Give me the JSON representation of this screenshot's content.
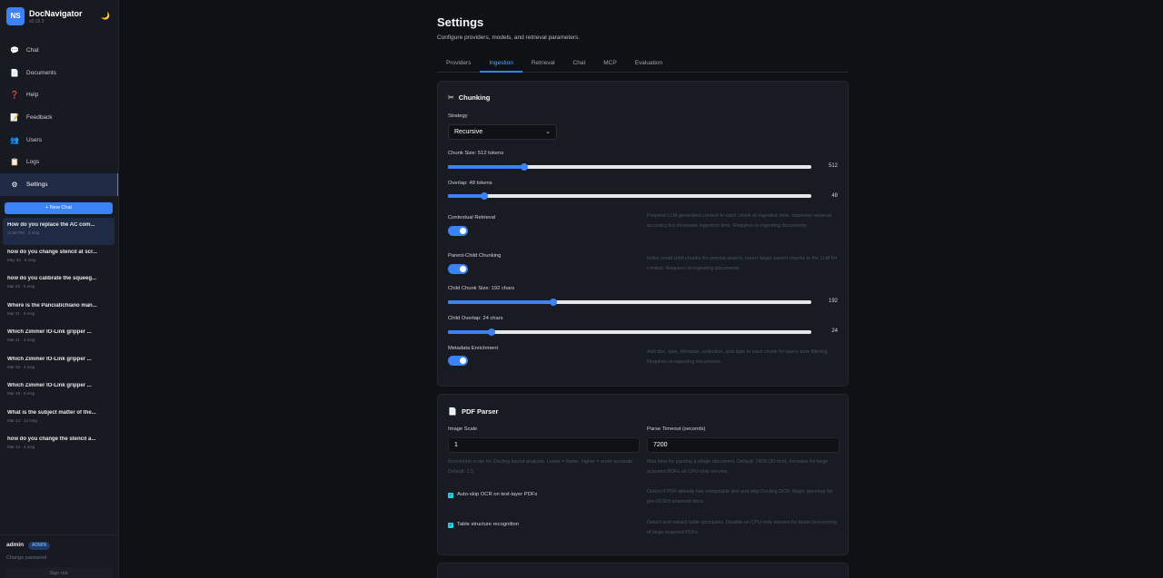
{
  "app": {
    "initials": "NS",
    "name": "DocNavigator",
    "version": "v0.15.3",
    "theme_icon": "moon-icon"
  },
  "nav": [
    {
      "icon": "💬",
      "label": "Chat"
    },
    {
      "icon": "📄",
      "label": "Documents"
    },
    {
      "icon": "❓",
      "label": "Help"
    },
    {
      "icon": "📝",
      "label": "Feedback"
    },
    {
      "icon": "👥",
      "label": "Users"
    },
    {
      "icon": "📋",
      "label": "Logs"
    },
    {
      "icon": "⚙",
      "label": "Settings"
    }
  ],
  "new_chat_label": "+ New Chat",
  "chats": [
    {
      "title": "How do you replace the AC com...",
      "meta": "11:55 PM · 2 msg"
    },
    {
      "title": "how do you change stencil at scr...",
      "meta": "May 26 · 8 msg"
    },
    {
      "title": "how do you calibrate the squeeg...",
      "meta": "Mar 22 · 6 msg"
    },
    {
      "title": "Where is the Panciatichiano man...",
      "meta": "Mar 21 · 6 msg"
    },
    {
      "title": "Which Zimmer IO-Link gripper ...",
      "meta": "Mar 21 · 4 msg"
    },
    {
      "title": "Which Zimmer IO-Link gripper ...",
      "meta": "Mar 20 · 4 msg"
    },
    {
      "title": "Which Zimmer IO-Link gripper ...",
      "meta": "Mar 19 · 6 msg"
    },
    {
      "title": "What is the subject matter of the...",
      "meta": "Mar 14 · 14 msg"
    },
    {
      "title": "how do you change the stencil a...",
      "meta": "Mar 12 · 4 msg"
    }
  ],
  "user": {
    "name": "admin",
    "role": "ADMIN",
    "change_password": "Change password",
    "sign_out": "Sign out"
  },
  "page": {
    "title": "Settings",
    "subtitle": "Configure providers, models, and retrieval parameters."
  },
  "tabs": [
    "Providers",
    "Ingestion",
    "Retrieval",
    "Chat",
    "MCP",
    "Evaluation"
  ],
  "chunking": {
    "title": "Chunking",
    "strategy_label": "Strategy",
    "strategy_value": "Recursive",
    "chunk_size_label": "Chunk Size: 512 tokens",
    "chunk_size_value": "512",
    "chunk_size_fraction": 0.21,
    "overlap_label": "Overlap: 48 tokens",
    "overlap_value": "48",
    "overlap_fraction": 0.1,
    "contextual_label": "Contextual Retrieval",
    "contextual_on": true,
    "contextual_desc": "Prepend LLM-generated context to each chunk at ingestion time. Improves retrieval accuracy but increases ingestion time. Requires re-ingesting documents.",
    "parent_child_label": "Parent-Child Chunking",
    "parent_child_on": true,
    "parent_child_desc": "Index small child chunks for precise search, return larger parent chunks to the LLM for context. Requires re-ingesting documents.",
    "child_size_label": "Child Chunk Size: 192 chars",
    "child_size_value": "192",
    "child_size_fraction": 0.29,
    "child_overlap_label": "Child Overlap: 24 chars",
    "child_overlap_value": "24",
    "child_overlap_fraction": 0.12,
    "metadata_label": "Metadata Enrichment",
    "metadata_on": true,
    "metadata_desc": "Add doc, type, filename, collection, and date to each chunk for query-time filtering. Requires re-ingesting documents."
  },
  "pdf": {
    "title": "PDF Parser",
    "image_scale_label": "Image Scale",
    "image_scale_value": "1",
    "image_scale_desc": "Resolution scale for Docling layout analysis. Lower = faster, higher = more accurate. Default: 1.5",
    "timeout_label": "Parse Timeout (seconds)",
    "timeout_value": "7200",
    "timeout_desc": "Max time for parsing a single document. Default: 1800 (30 min). Increase for large scanned PDFs on CPU-only servers.",
    "auto_skip_label": "Auto-skip OCR on text-layer PDFs",
    "auto_skip_checked": true,
    "auto_skip_desc": "Detect if PDF already has extractable text and skip Docling OCR. Major speedup for pre-OCR'd scanned docs.",
    "table_label": "Table structure recognition",
    "table_checked": true,
    "table_desc": "Detect and extract table structures. Disable on CPU-only servers for faster processing of large scanned PDFs."
  }
}
